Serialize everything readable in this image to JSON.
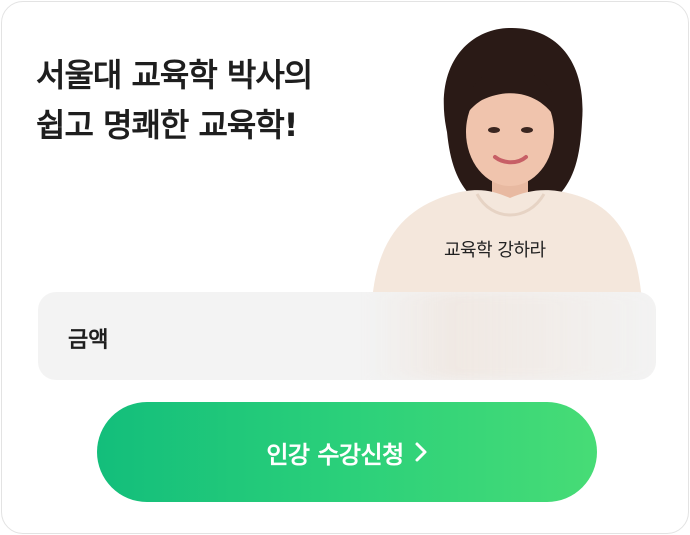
{
  "headline": {
    "line1": "서울대 교육학 박사의",
    "line2": "쉽고 명쾌한 교육학!"
  },
  "instructor": {
    "caption": "교육학 강하라"
  },
  "price": {
    "label": "금액"
  },
  "cta": {
    "label": "인강 수강신청",
    "icon": "chevron-right-icon",
    "gradient_start": "#13be7b",
    "gradient_end": "#47dc76"
  }
}
